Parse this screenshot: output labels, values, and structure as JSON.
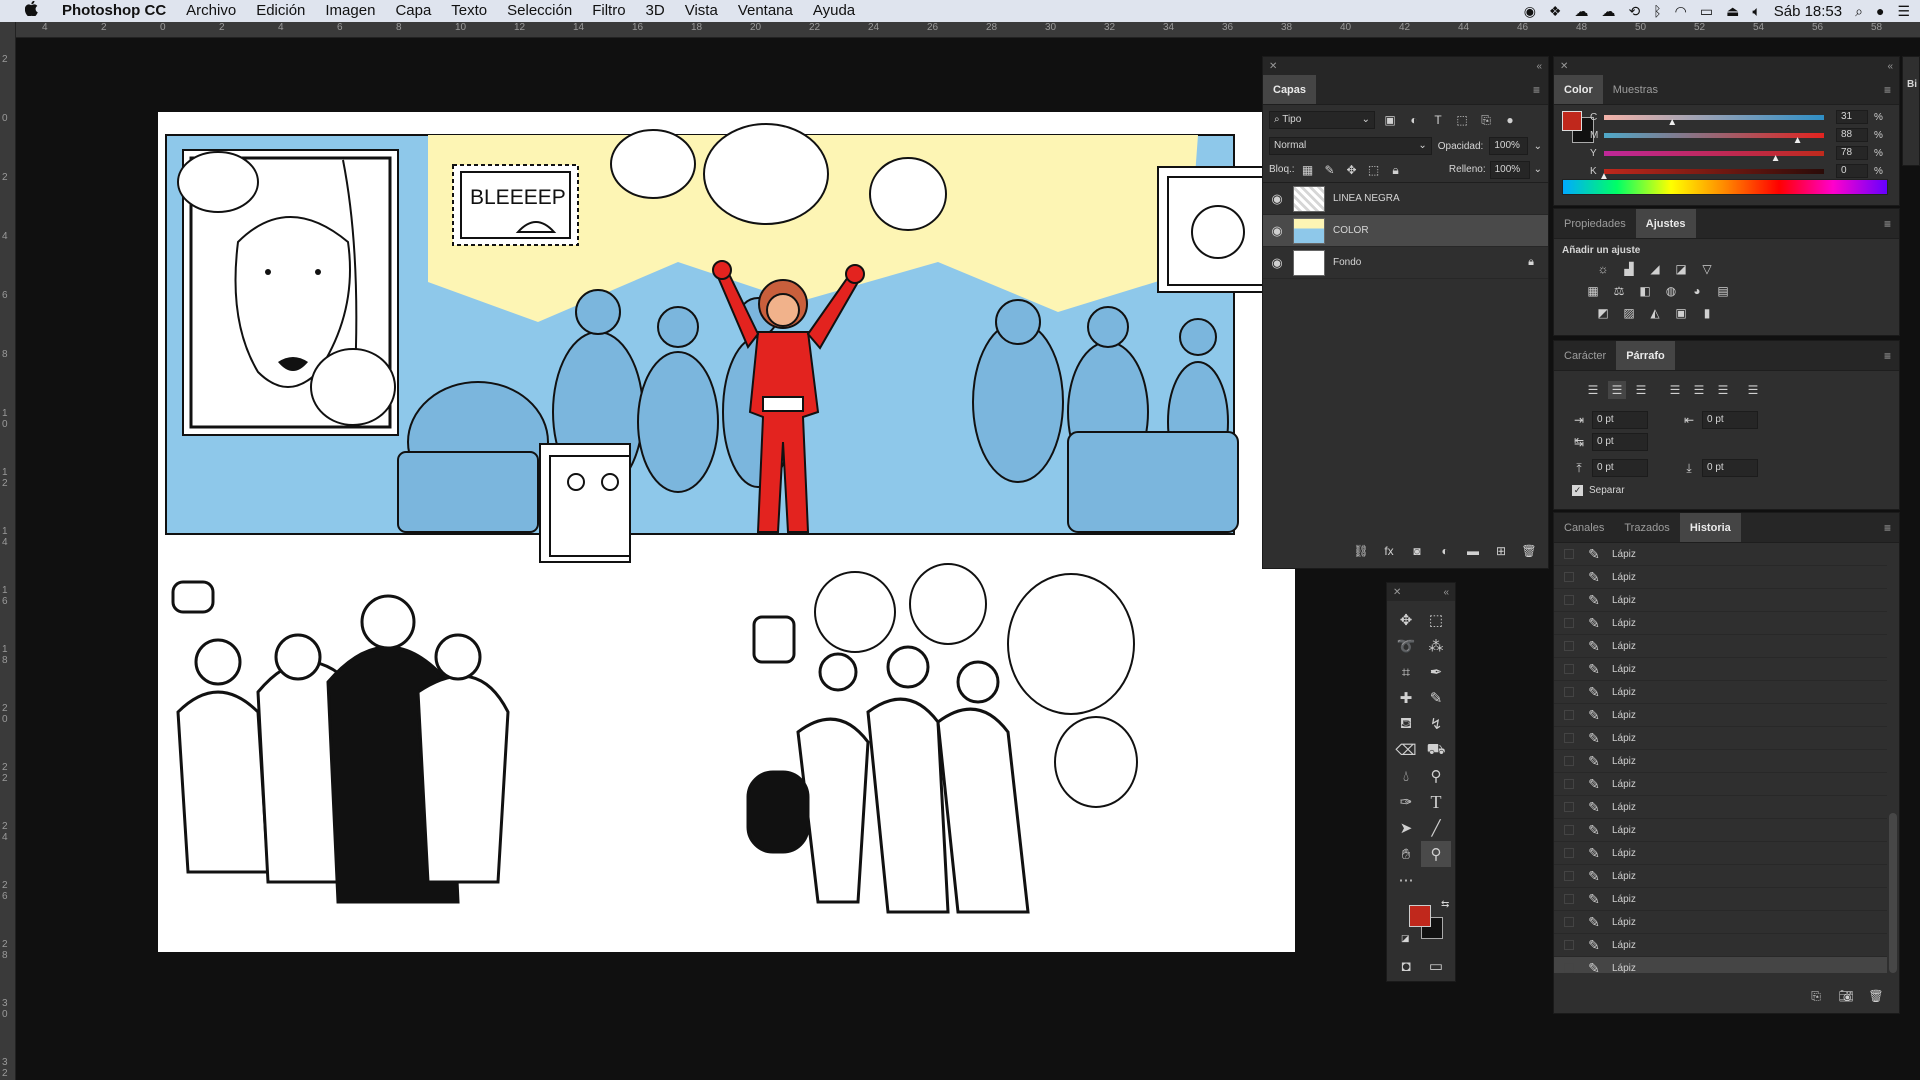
{
  "menubar": {
    "apple": "",
    "app_name": "Photoshop CC",
    "items": [
      "Archivo",
      "Edición",
      "Imagen",
      "Capa",
      "Texto",
      "Selección",
      "Filtro",
      "3D",
      "Vista",
      "Ventana",
      "Ayuda"
    ],
    "status_icons": [
      "record-icon",
      "dropbox-icon",
      "cloud-icon",
      "cloud-upload-icon",
      "time-machine-icon",
      "bluetooth-icon",
      "wifi-icon",
      "airplay-icon",
      "eject-icon",
      "volume-icon"
    ],
    "clock": "Sáb 18:53"
  },
  "rulers": {
    "h_labels": [
      "4",
      "2",
      "0",
      "2",
      "4",
      "6",
      "8",
      "10",
      "12",
      "14",
      "16",
      "18",
      "20",
      "22",
      "24",
      "26",
      "28",
      "30",
      "32",
      "34",
      "36",
      "38",
      "40",
      "42",
      "44",
      "46",
      "48",
      "50",
      "52",
      "54",
      "56",
      "58"
    ],
    "v_labels": [
      "2",
      "0",
      "2",
      "4",
      "6",
      "8",
      "1 0",
      "1 2",
      "1 4",
      "1 6",
      "1 8",
      "2 0",
      "2 2",
      "2 4",
      "2 6",
      "2 8",
      "3 0",
      "3 2"
    ]
  },
  "canvas": {
    "sfx_text": "BLEEEEP"
  },
  "layers_panel": {
    "tab": "Capas",
    "filter_label": "Tipo",
    "blend_mode": "Normal",
    "opacity_label": "Opacidad:",
    "opacity_value": "100%",
    "lock_label": "Bloq.:",
    "fill_label": "Relleno:",
    "fill_value": "100%",
    "layers": [
      {
        "name": "LINEA NEGRA",
        "selected": false
      },
      {
        "name": "COLOR",
        "selected": true
      },
      {
        "name": "Fondo",
        "selected": false,
        "locked": true
      }
    ]
  },
  "color_panel": {
    "tabs": [
      "Color",
      "Muestras"
    ],
    "channels": [
      {
        "label": "C",
        "value": "31",
        "unit": "%",
        "level": 0.31
      },
      {
        "label": "M",
        "value": "88",
        "unit": "%",
        "level": 0.88
      },
      {
        "label": "Y",
        "value": "78",
        "unit": "%",
        "level": 0.78
      },
      {
        "label": "K",
        "value": "0",
        "unit": "%",
        "level": 0.0
      }
    ],
    "foreground_color": "#c0281c",
    "background_color": "#111111"
  },
  "adjustments_panel": {
    "tabs": [
      "Propiedades",
      "Ajustes"
    ],
    "add_label": "Añadir un ajuste"
  },
  "paragraph_panel": {
    "tabs": [
      "Carácter",
      "Párrafo"
    ],
    "fields": [
      "0 pt",
      "0 pt",
      "0 pt",
      "0 pt",
      "0 pt"
    ],
    "hyphenate_label": "Separar"
  },
  "history_panel": {
    "tabs": [
      "Canales",
      "Trazados",
      "Historia"
    ],
    "items": [
      "Lápiz",
      "Lápiz",
      "Lápiz",
      "Lápiz",
      "Lápiz",
      "Lápiz",
      "Lápiz",
      "Lápiz",
      "Lápiz",
      "Lápiz",
      "Lápiz",
      "Lápiz",
      "Lápiz",
      "Lápiz",
      "Lápiz",
      "Lápiz",
      "Lápiz",
      "Lápiz",
      "Lápiz"
    ]
  },
  "side_stub": {
    "label": "Bi"
  }
}
